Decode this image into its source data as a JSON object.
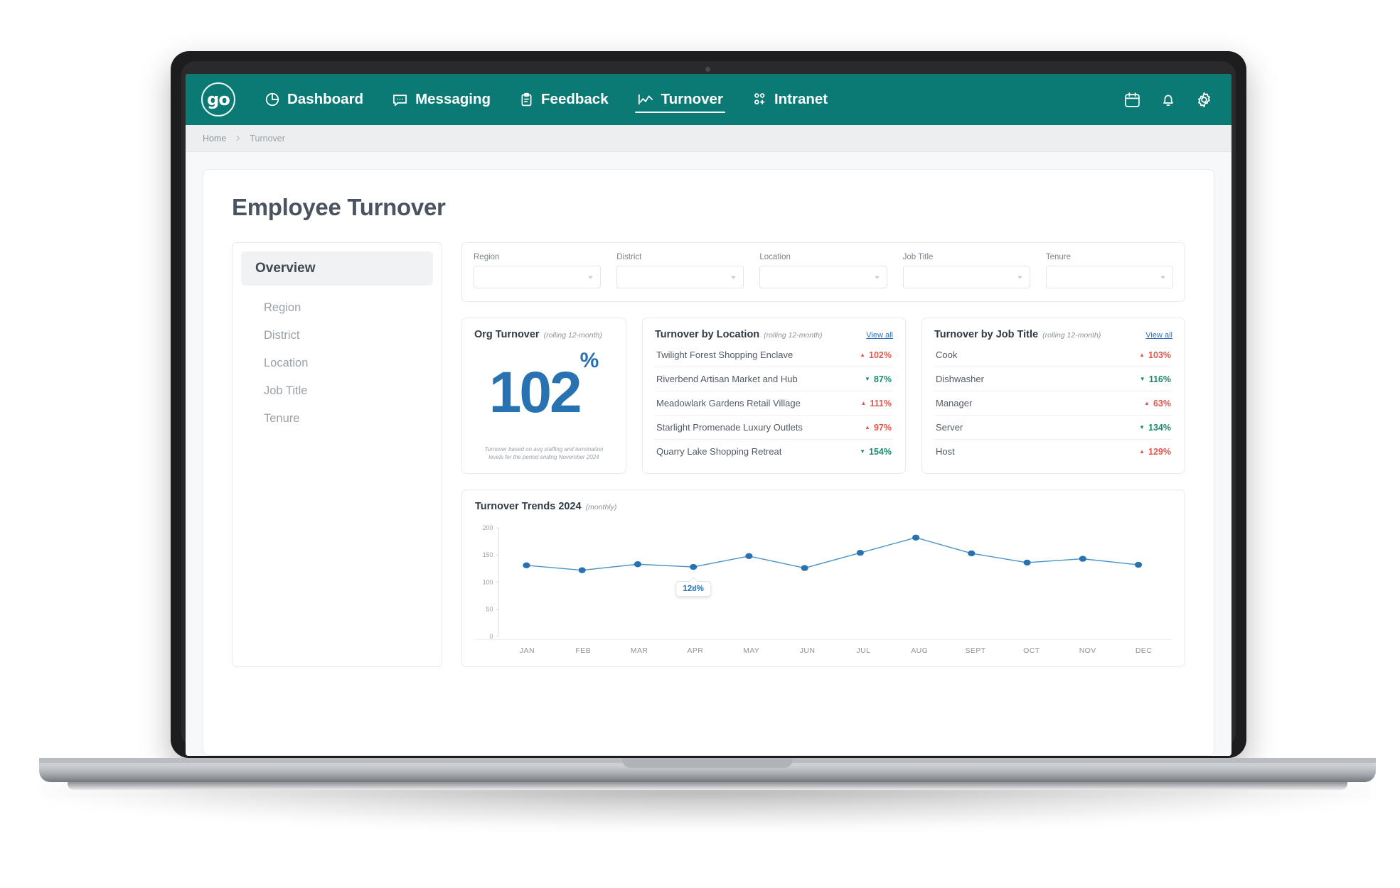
{
  "nav": {
    "brand_text": "go",
    "items": [
      {
        "label": "Dashboard",
        "icon": "dashboard-pie-icon",
        "active": false
      },
      {
        "label": "Messaging",
        "icon": "chat-bubble-icon",
        "active": false
      },
      {
        "label": "Feedback",
        "icon": "clipboard-icon",
        "active": false
      },
      {
        "label": "Turnover",
        "icon": "line-chart-icon",
        "active": true
      },
      {
        "label": "Intranet",
        "icon": "people-icon",
        "active": false
      }
    ],
    "actions": [
      {
        "name": "calendar-icon"
      },
      {
        "name": "bell-icon"
      },
      {
        "name": "gear-icon"
      }
    ],
    "bg_color": "#0b7a74"
  },
  "breadcrumb": {
    "home": "Home",
    "current": "Turnover"
  },
  "page": {
    "title": "Employee Turnover"
  },
  "sidebar": {
    "overview_label": "Overview",
    "items": [
      {
        "label": "Region"
      },
      {
        "label": "District"
      },
      {
        "label": "Location"
      },
      {
        "label": "Job Title"
      },
      {
        "label": "Tenure"
      }
    ]
  },
  "filters": [
    {
      "label": "Region",
      "value": "",
      "placeholder": ""
    },
    {
      "label": "District",
      "value": "",
      "placeholder": ""
    },
    {
      "label": "Location",
      "value": "",
      "placeholder": ""
    },
    {
      "label": "Job Title",
      "value": "",
      "placeholder": ""
    },
    {
      "label": "Tenure",
      "value": "",
      "placeholder": ""
    }
  ],
  "org_turnover": {
    "title": "Org Turnover",
    "subtitle": "(rolling 12-month)",
    "value": "102",
    "unit": "%",
    "footnote": "Turnover based on avg staffing and termination levels for the period ending November 2024",
    "accent_color": "#2872b2"
  },
  "by_location": {
    "title": "Turnover by Location",
    "subtitle": "(rolling 12-month)",
    "view_all": "View all",
    "rows": [
      {
        "name": "Twilight Forest Shopping Enclave",
        "value": "102%",
        "direction": "up"
      },
      {
        "name": "Riverbend Artisan Market and Hub",
        "value": "87%",
        "direction": "down"
      },
      {
        "name": "Meadowlark Gardens Retail Village",
        "value": "111%",
        "direction": "up"
      },
      {
        "name": "Starlight Promenade Luxury Outlets",
        "value": "97%",
        "direction": "up"
      },
      {
        "name": "Quarry Lake Shopping Retreat",
        "value": "154%",
        "direction": "down"
      }
    ]
  },
  "by_job_title": {
    "title": "Turnover by Job Title",
    "subtitle": "(rolling 12-month)",
    "view_all": "View all",
    "rows": [
      {
        "name": "Cook",
        "value": "103%",
        "direction": "up"
      },
      {
        "name": "Dishwasher",
        "value": "116%",
        "direction": "down"
      },
      {
        "name": "Manager",
        "value": "63%",
        "direction": "up"
      },
      {
        "name": "Server",
        "value": "134%",
        "direction": "down"
      },
      {
        "name": "Host",
        "value": "129%",
        "direction": "up"
      }
    ]
  },
  "colors": {
    "up": "#e2574c",
    "down": "#1c8a70",
    "link": "#2d72b8",
    "brand": "#0b7a74"
  },
  "chart_data": {
    "type": "line",
    "title": "Turnover Trends 2024",
    "subtitle": "(monthly)",
    "xlabel": "",
    "ylabel": "",
    "ylim": [
      0,
      200
    ],
    "yticks": [
      0,
      50,
      100,
      150,
      200
    ],
    "grid": false,
    "legend": "none",
    "line_color": "#4a93c9",
    "point_color": "#2872b2",
    "categories": [
      "JAN",
      "FEB",
      "MAR",
      "APR",
      "MAY",
      "JUN",
      "JUL",
      "AUG",
      "SEPT",
      "OCT",
      "NOV",
      "DEC"
    ],
    "values": [
      131,
      122,
      133,
      128,
      148,
      126,
      154,
      182,
      153,
      136,
      143,
      132
    ],
    "annotation": {
      "category": "APR",
      "label": "128%",
      "value": 128
    }
  }
}
